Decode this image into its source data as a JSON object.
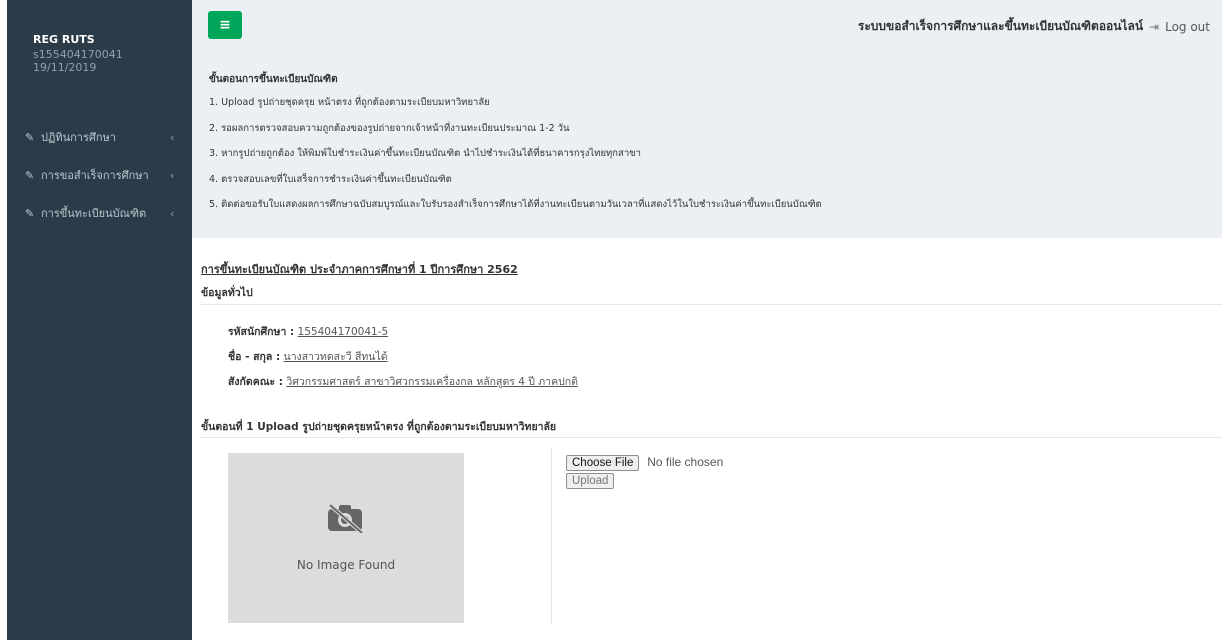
{
  "sidebar": {
    "brand": "REG RUTS",
    "user_id": "s155404170041",
    "date": "19/11/2019",
    "items": [
      {
        "label": "ปฏิทินการศึกษา"
      },
      {
        "label": "การขอสำเร็จการศึกษา"
      },
      {
        "label": "การขึ้นทะเบียนบัณฑิต"
      }
    ]
  },
  "header": {
    "menu_icon": "≡",
    "system_title": "ระบบขอสำเร็จการศึกษาและขึ้นทะเบียนบัณฑิตออนไลน์",
    "logout": "Log out"
  },
  "steps": {
    "title": "ขั้นตอนการขึ้นทะเบียนบัณฑิต",
    "items": [
      "1. Upload รูปถ่ายชุดครุย หน้าตรง ที่ถูกต้องตามระเบียบมหาวิทยาลัย",
      "2. รอผลการตรวจสอบความถูกต้องของรูปถ่ายจากเจ้าหน้าที่งานทะเบียนประมาณ 1-2 วัน",
      "3. หากรูปถ่ายถูกต้อง ให้พิมพ์ใบชำระเงินค่าขึ้นทะเบียนบัณฑิต นำไปชำระเงินได้ที่ธนาคารกรุงไทยทุกสาขา",
      "4. ตรวจสอบเลขที่ใบเสร็จการชำระเงินค่าขึ้นทะเบียนบัณฑิต",
      "5. ติดต่อขอรับใบแสดงผลการศึกษาฉบับสมบูรณ์และใบรับรองสำเร็จการศึกษาได้ที่งานทะเบียนตามวันเวลาที่แสดงไว้ในใบชำระเงินค่าขึ้นทะเบียนบัณฑิต"
    ]
  },
  "main": {
    "section_title": "การขึ้นทะเบียนบัณฑิต ประจำภาคการศึกษาที่ 1 ปีการศึกษา 2562",
    "general": "ข้อมูลทั่วไป",
    "student_id_label": "รหัสนักศึกษา :",
    "student_id": "155404170041-5",
    "name_label": "ชื่อ - สกุล :",
    "name": "นางสาวทดสะวี สีทนได้",
    "faculty_label": "สังกัดคณะ :",
    "faculty": "วิศวกรรมศาสตร์ สาขาวิศวกรรมเครื่องกล หลักสูตร 4 ปี ภาคปกติ",
    "step1": "ขั้นตอนที่ 1 Upload รูปถ่ายชุดครุยหน้าตรง ที่ถูกต้องตามระเบียบมหาวิทยาลัย",
    "no_image": "No Image Found",
    "choose_file": "Choose File",
    "no_file": "No file chosen",
    "upload": "Upload"
  },
  "colors": {
    "sidebar_bg": "#2c3b48",
    "menu_button": "#00a65a",
    "header_bg": "#ecf0f5"
  }
}
